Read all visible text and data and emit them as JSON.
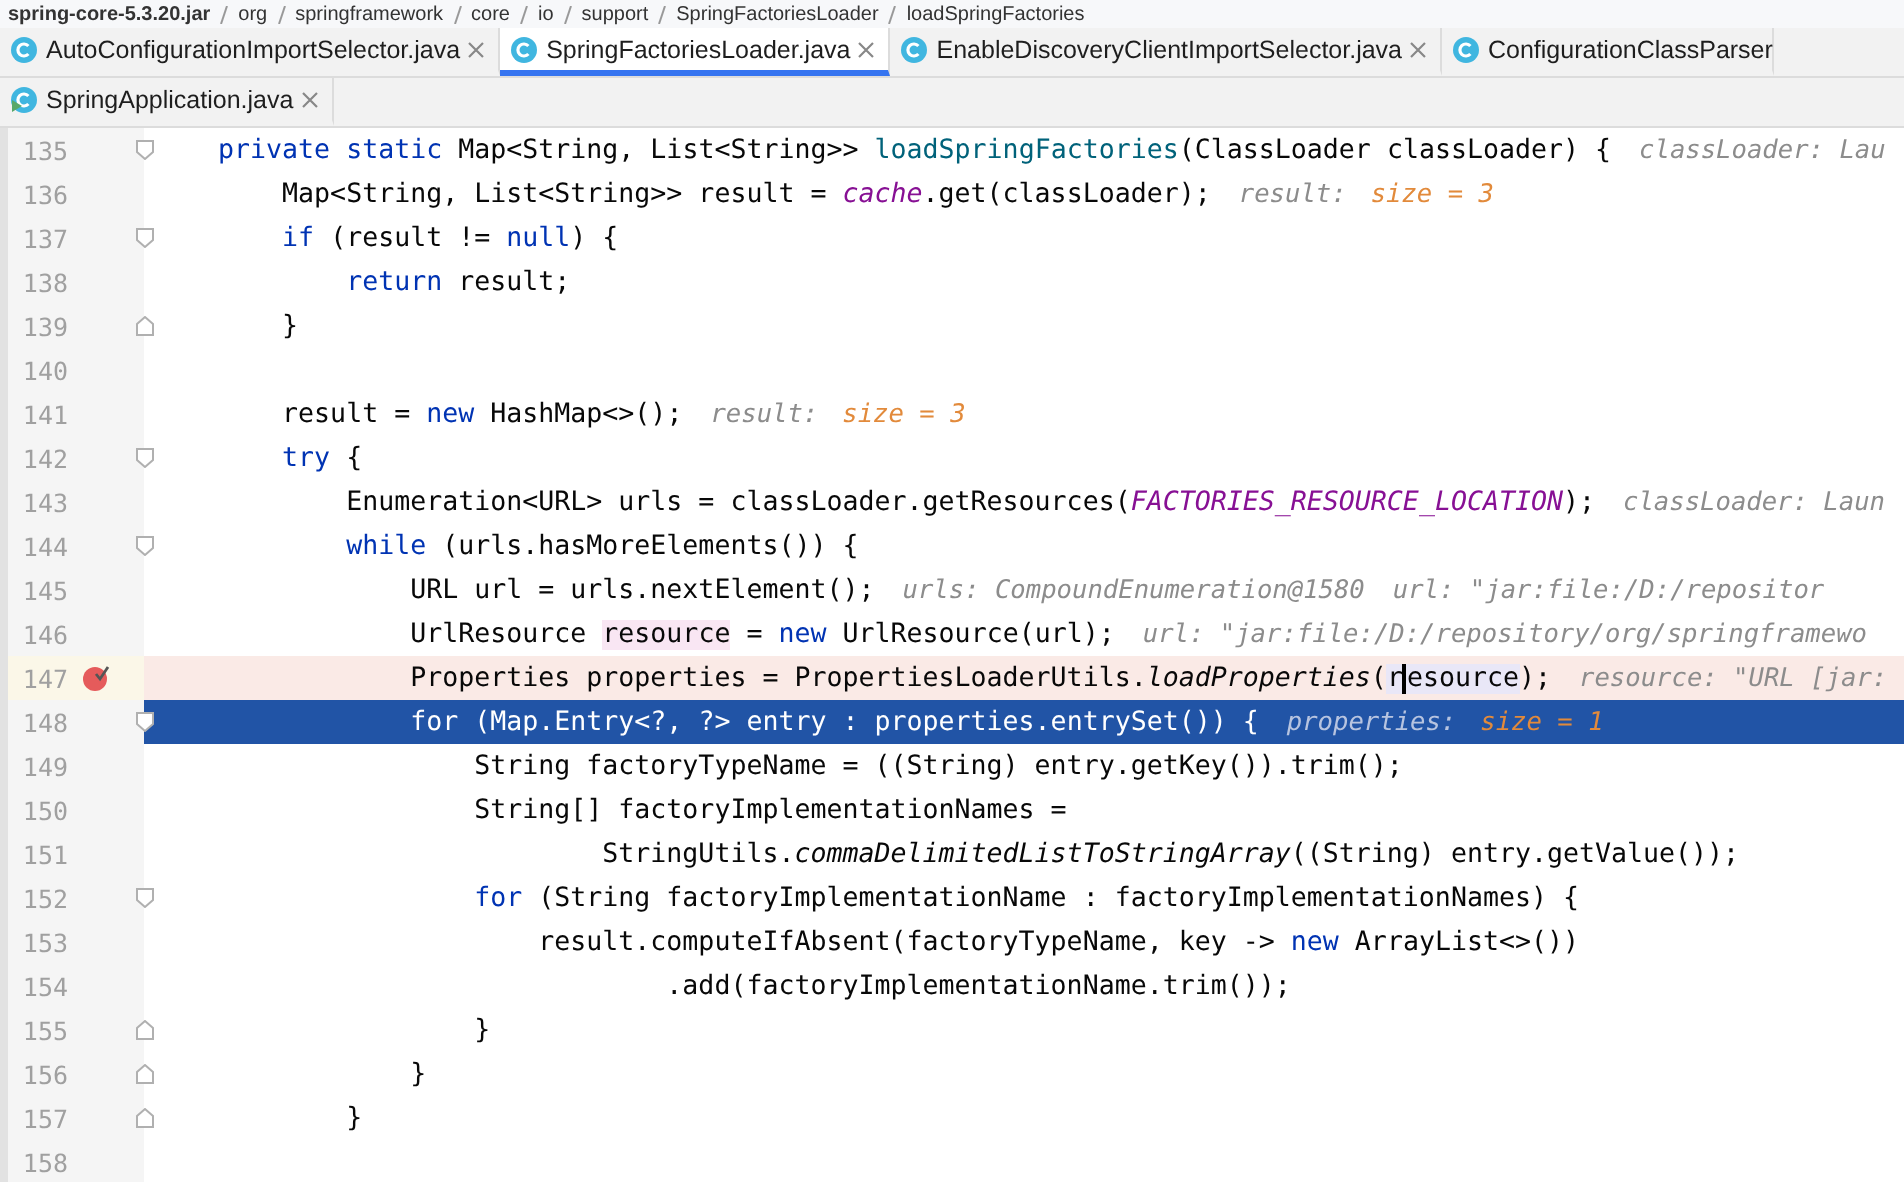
{
  "breadcrumbs": [
    {
      "label": "spring-core-5.3.20.jar",
      "kind": "jar"
    },
    {
      "label": "org",
      "kind": "package"
    },
    {
      "label": "springframework",
      "kind": "package"
    },
    {
      "label": "core",
      "kind": "package"
    },
    {
      "label": "io",
      "kind": "package"
    },
    {
      "label": "support",
      "kind": "package"
    },
    {
      "label": "SpringFactoriesLoader",
      "kind": "class"
    },
    {
      "label": "loadSpringFactories",
      "kind": "method"
    }
  ],
  "tab_rows": [
    [
      {
        "label": "AutoConfigurationImportSelector.java",
        "selected": false,
        "kind": "class",
        "closable": true
      },
      {
        "label": "SpringFactoriesLoader.java",
        "selected": true,
        "kind": "class",
        "closable": true
      },
      {
        "label": "EnableDiscoveryClientImportSelector.java",
        "selected": false,
        "kind": "class",
        "closable": true
      },
      {
        "label": "ConfigurationClassParser",
        "selected": false,
        "kind": "class",
        "closable": false
      }
    ],
    [
      {
        "label": "SpringApplication.java",
        "selected": false,
        "kind": "runnable",
        "closable": true
      }
    ]
  ],
  "lines": [
    {
      "number": "135",
      "kind": "normal",
      "fold_start": true,
      "fold_end": false,
      "tokens": [
        {
          "kind": "keyword",
          "text": "    private static"
        },
        {
          "kind": "plain",
          "text": " Map<String, List<String>> "
        },
        {
          "kind": "declaration",
          "text": "loadSpringFactories"
        },
        {
          "kind": "plain",
          "text": "(ClassLoader classLoader) {"
        },
        {
          "kind": "hint",
          "text": "classLoader: Lau"
        }
      ]
    },
    {
      "number": "136",
      "kind": "normal",
      "fold_start": false,
      "fold_end": false,
      "tokens": [
        {
          "kind": "plain",
          "text": "        Map<String, List<String>> result = "
        },
        {
          "kind": "field",
          "text": "cache"
        },
        {
          "kind": "plain",
          "text": ".get(classLoader);"
        },
        {
          "kind": "hint",
          "text": "result:"
        },
        {
          "kind": "hint-value",
          "text": "size = 3"
        }
      ]
    },
    {
      "number": "137",
      "kind": "normal",
      "fold_start": true,
      "fold_end": false,
      "tokens": [
        {
          "kind": "keyword",
          "text": "        if"
        },
        {
          "kind": "plain",
          "text": " (result != "
        },
        {
          "kind": "keyword",
          "text": "null"
        },
        {
          "kind": "plain",
          "text": ") {"
        }
      ]
    },
    {
      "number": "138",
      "kind": "normal",
      "fold_start": false,
      "fold_end": false,
      "tokens": [
        {
          "kind": "keyword",
          "text": "            return"
        },
        {
          "kind": "plain",
          "text": " result;"
        }
      ]
    },
    {
      "number": "139",
      "kind": "normal",
      "fold_start": false,
      "fold_end": true,
      "tokens": [
        {
          "kind": "plain",
          "text": "        }"
        }
      ]
    },
    {
      "number": "140",
      "kind": "normal",
      "fold_start": false,
      "fold_end": false
    },
    {
      "number": "141",
      "kind": "normal",
      "fold_start": false,
      "fold_end": false,
      "tokens": [
        {
          "kind": "plain",
          "text": "        result = "
        },
        {
          "kind": "keyword",
          "text": "new"
        },
        {
          "kind": "plain",
          "text": " HashMap<>();"
        },
        {
          "kind": "hint",
          "text": "result:"
        },
        {
          "kind": "hint-value",
          "text": "size = 3"
        }
      ]
    },
    {
      "number": "142",
      "kind": "normal",
      "fold_start": true,
      "fold_end": false,
      "tokens": [
        {
          "kind": "keyword",
          "text": "        try"
        },
        {
          "kind": "plain",
          "text": " {"
        }
      ]
    },
    {
      "number": "143",
      "kind": "normal",
      "fold_start": false,
      "fold_end": false,
      "tokens": [
        {
          "kind": "plain",
          "text": "            Enumeration<URL> urls = classLoader.getResources("
        },
        {
          "kind": "field",
          "text": "FACTORIES_RESOURCE_LOCATION"
        },
        {
          "kind": "plain",
          "text": ");"
        },
        {
          "kind": "hint",
          "text": "classLoader: Laun"
        }
      ]
    },
    {
      "number": "144",
      "kind": "normal",
      "fold_start": true,
      "fold_end": false,
      "tokens": [
        {
          "kind": "keyword",
          "text": "            while"
        },
        {
          "kind": "plain",
          "text": " (urls.hasMoreElements()) {"
        }
      ]
    },
    {
      "number": "145",
      "kind": "normal",
      "fold_start": false,
      "fold_end": false,
      "tokens": [
        {
          "kind": "plain",
          "text": "                URL url = urls.nextElement();"
        },
        {
          "kind": "hint",
          "text": "urls: CompoundEnumeration@1580"
        },
        {
          "kind": "hint",
          "text": "url: \"jar:file:/D:/repositor"
        }
      ]
    },
    {
      "number": "146",
      "kind": "normal",
      "fold_start": false,
      "fold_end": false,
      "tokens": [
        {
          "kind": "plain",
          "text": "                UrlResource "
        },
        {
          "kind": "write-usage",
          "text": "resource"
        },
        {
          "kind": "plain",
          "text": " = "
        },
        {
          "kind": "keyword",
          "text": "new"
        },
        {
          "kind": "plain",
          "text": " UrlResource(url);"
        },
        {
          "kind": "hint",
          "text": "url: \"jar:file:/D:/repository/org/springframewo"
        }
      ]
    },
    {
      "number": "147",
      "kind": "breakpoint",
      "fold_start": false,
      "fold_end": false,
      "tokens": [
        {
          "kind": "plain",
          "text": "                Properties properties = PropertiesLoaderUtils."
        },
        {
          "kind": "static",
          "text": "loadProperties"
        },
        {
          "kind": "plain",
          "text": "("
        },
        {
          "kind": "read-usage",
          "text": "r"
        },
        {
          "kind": "read-usage-caret",
          "text": "esource"
        },
        {
          "kind": "plain",
          "text": ");"
        },
        {
          "kind": "hint",
          "text": "resource: \"URL [jar:"
        }
      ]
    },
    {
      "number": "148",
      "kind": "execution",
      "fold_start": true,
      "fold_end": false,
      "tokens": [
        {
          "kind": "keyword",
          "text": "                for"
        },
        {
          "kind": "plain",
          "text": " (Map.Entry<?, ?> entry : properties.entrySet()) {"
        },
        {
          "kind": "hint",
          "text": "properties:"
        },
        {
          "kind": "hint-value",
          "text": "size = 1"
        }
      ]
    },
    {
      "number": "149",
      "kind": "normal",
      "fold_start": false,
      "fold_end": false,
      "tokens": [
        {
          "kind": "plain",
          "text": "                    String factoryTypeName = ((String) entry.getKey()).trim();"
        }
      ]
    },
    {
      "number": "150",
      "kind": "normal",
      "fold_start": false,
      "fold_end": false,
      "tokens": [
        {
          "kind": "plain",
          "text": "                    String[] factoryImplementationNames ="
        }
      ]
    },
    {
      "number": "151",
      "kind": "normal",
      "fold_start": false,
      "fold_end": false,
      "tokens": [
        {
          "kind": "plain",
          "text": "                            StringUtils."
        },
        {
          "kind": "static",
          "text": "commaDelimitedListToStringArray"
        },
        {
          "kind": "plain",
          "text": "((String) entry.getValue());"
        }
      ]
    },
    {
      "number": "152",
      "kind": "normal",
      "fold_start": true,
      "fold_end": false,
      "tokens": [
        {
          "kind": "keyword",
          "text": "                    for"
        },
        {
          "kind": "plain",
          "text": " (String factoryImplementationName : factoryImplementationNames) {"
        }
      ]
    },
    {
      "number": "153",
      "kind": "normal",
      "fold_start": false,
      "fold_end": false,
      "tokens": [
        {
          "kind": "plain",
          "text": "                        result.computeIfAbsent(factoryTypeName, key -> "
        },
        {
          "kind": "keyword",
          "text": "new"
        },
        {
          "kind": "plain",
          "text": " ArrayList<>())"
        }
      ]
    },
    {
      "number": "154",
      "kind": "normal",
      "fold_start": false,
      "fold_end": false,
      "tokens": [
        {
          "kind": "plain",
          "text": "                                .add(factoryImplementationName.trim());"
        }
      ]
    },
    {
      "number": "155",
      "kind": "normal",
      "fold_start": false,
      "fold_end": true,
      "tokens": [
        {
          "kind": "plain",
          "text": "                    }"
        }
      ]
    },
    {
      "number": "156",
      "kind": "normal",
      "fold_start": false,
      "fold_end": true,
      "tokens": [
        {
          "kind": "plain",
          "text": "                }"
        }
      ]
    },
    {
      "number": "157",
      "kind": "normal",
      "fold_start": false,
      "fold_end": true,
      "tokens": [
        {
          "kind": "plain",
          "text": "            }"
        }
      ]
    },
    {
      "number": "158",
      "kind": "normal",
      "fold_start": false,
      "fold_end": false
    }
  ]
}
